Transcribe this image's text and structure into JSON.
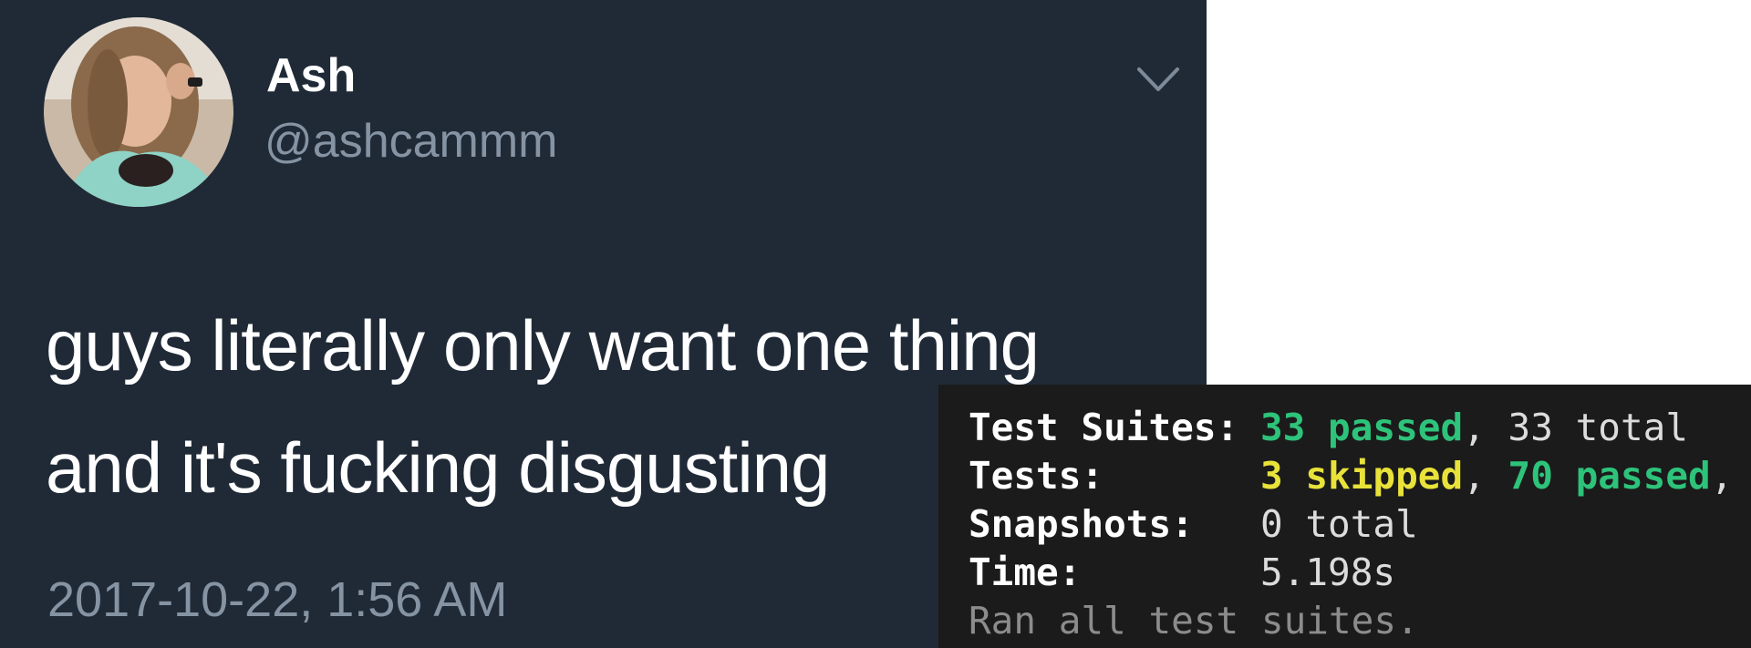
{
  "tweet": {
    "display_name": "Ash",
    "handle": "@ashcammm",
    "text_line_1": "guys literally only want one thing",
    "text_line_2": "and it's fucking disgusting",
    "timestamp": "2017-10-22, 1:56 AM",
    "menu_icon": "chevron-down-icon",
    "background_color": "#202a37",
    "secondary_text_color": "#8593a3"
  },
  "terminal": {
    "background_color": "#1b1b1b",
    "rows": [
      {
        "label": "Test Suites:",
        "parts": [
          {
            "text": "33 passed",
            "color": "green"
          },
          {
            "text": ", 33 total",
            "color": "plain"
          }
        ]
      },
      {
        "label": "Tests:",
        "parts": [
          {
            "text": "3 skipped",
            "color": "yellow"
          },
          {
            "text": ", ",
            "color": "plain"
          },
          {
            "text": "70 passed",
            "color": "green"
          },
          {
            "text": ",",
            "color": "plain"
          }
        ]
      },
      {
        "label": "Snapshots:",
        "parts": [
          {
            "text": "0 total",
            "color": "plain"
          }
        ]
      },
      {
        "label": "Time:",
        "parts": [
          {
            "text": "5.198s",
            "color": "plain"
          }
        ]
      }
    ],
    "footer": "Ran all test suites.",
    "colors": {
      "green": "#2ec37a",
      "yellow": "#e8e23a",
      "dim": "#8c8c8c"
    }
  }
}
